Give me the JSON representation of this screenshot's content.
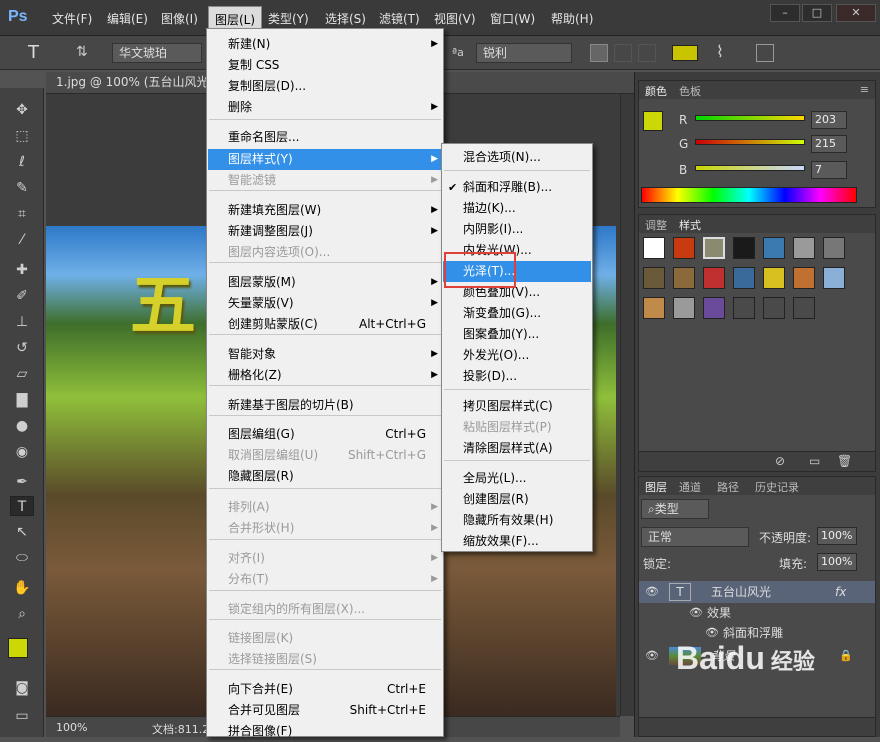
{
  "menubar": {
    "logo": "Ps",
    "items": [
      "文件(F)",
      "编辑(E)",
      "图像(I)",
      "图层(L)",
      "类型(Y)",
      "选择(S)",
      "滤镜(T)",
      "视图(V)",
      "窗口(W)",
      "帮助(H)"
    ],
    "window_buttons": [
      "–",
      "□",
      "✕"
    ]
  },
  "options": {
    "font_family": "华文琥珀",
    "antialias": "锐利",
    "tool_glyph": "T",
    "color": "#c8c400"
  },
  "document": {
    "tab_title": "1.jpg @ 100% (五台山风光,",
    "zoom": "100%",
    "doc_info": "文档:811.2"
  },
  "canvas": {
    "overlay_text": "五"
  },
  "color_panel": {
    "tabs": [
      "颜色",
      "色板"
    ],
    "labels": [
      "R",
      "G",
      "B"
    ],
    "values": [
      "203",
      "215",
      "7"
    ],
    "fg_color": "#cbd707",
    "bg_color": "#ffffff"
  },
  "styles_panel": {
    "tabs": [
      "调整",
      "样式"
    ]
  },
  "layers_panel": {
    "tabs": [
      "图层",
      "通道",
      "路径",
      "历史记录"
    ],
    "filter_kind": "类型",
    "blend_mode": "正常",
    "opacity_label": "不透明度:",
    "opacity": "100%",
    "lock_label": "锁定:",
    "fill_label": "填充:",
    "fill": "100%",
    "layers": [
      {
        "name": "五台山风光",
        "type": "text",
        "fx": "fx"
      },
      {
        "name": "效果",
        "type": "effect-group"
      },
      {
        "name": "斜面和浮雕",
        "type": "effect"
      },
      {
        "name": "背景",
        "type": "background"
      }
    ]
  },
  "layer_menu": {
    "items": [
      {
        "label": "新建(N)",
        "submenu": true
      },
      {
        "label": "复制 CSS"
      },
      {
        "label": "复制图层(D)..."
      },
      {
        "label": "删除",
        "submenu": true
      },
      {
        "label": "重命名图层..."
      },
      {
        "label": "图层样式(Y)",
        "submenu": true,
        "highlight": true
      },
      {
        "label": "智能滤镜",
        "submenu": true,
        "disabled": true
      },
      {
        "label": "新建填充图层(W)",
        "submenu": true
      },
      {
        "label": "新建调整图层(J)",
        "submenu": true
      },
      {
        "label": "图层内容选项(O)...",
        "disabled": true
      },
      {
        "label": "图层蒙版(M)",
        "submenu": true
      },
      {
        "label": "矢量蒙版(V)",
        "submenu": true
      },
      {
        "label": "创建剪贴蒙版(C)",
        "shortcut": "Alt+Ctrl+G"
      },
      {
        "label": "智能对象",
        "submenu": true
      },
      {
        "label": "栅格化(Z)",
        "submenu": true
      },
      {
        "label": "新建基于图层的切片(B)"
      },
      {
        "label": "图层编组(G)",
        "shortcut": "Ctrl+G"
      },
      {
        "label": "取消图层编组(U)",
        "shortcut": "Shift+Ctrl+G",
        "disabled": true
      },
      {
        "label": "隐藏图层(R)"
      },
      {
        "label": "排列(A)",
        "submenu": true,
        "disabled": true
      },
      {
        "label": "合并形状(H)",
        "submenu": true,
        "disabled": true
      },
      {
        "label": "对齐(I)",
        "submenu": true,
        "disabled": true
      },
      {
        "label": "分布(T)",
        "submenu": true,
        "disabled": true
      },
      {
        "label": "锁定组内的所有图层(X)...",
        "disabled": true
      },
      {
        "label": "链接图层(K)",
        "disabled": true
      },
      {
        "label": "选择链接图层(S)",
        "disabled": true
      },
      {
        "label": "向下合并(E)",
        "shortcut": "Ctrl+E"
      },
      {
        "label": "合并可见图层",
        "shortcut": "Shift+Ctrl+E"
      },
      {
        "label": "拼合图像(F)"
      }
    ]
  },
  "style_submenu": {
    "items": [
      {
        "label": "混合选项(N)..."
      },
      {
        "label": "斜面和浮雕(B)...",
        "checked": true
      },
      {
        "label": "描边(K)..."
      },
      {
        "label": "内阴影(I)..."
      },
      {
        "label": "内发光(W)..."
      },
      {
        "label": "光泽(T)...",
        "highlight": true
      },
      {
        "label": "颜色叠加(V)..."
      },
      {
        "label": "渐变叠加(G)..."
      },
      {
        "label": "图案叠加(Y)..."
      },
      {
        "label": "外发光(O)..."
      },
      {
        "label": "投影(D)..."
      },
      {
        "label": "拷贝图层样式(C)"
      },
      {
        "label": "粘贴图层样式(P)",
        "disabled": true
      },
      {
        "label": "清除图层样式(A)"
      },
      {
        "label": "全局光(L)..."
      },
      {
        "label": "创建图层(R)"
      },
      {
        "label": "隐藏所有效果(H)"
      },
      {
        "label": "缩放效果(F)..."
      }
    ]
  },
  "watermark": {
    "brand": "Baidu",
    "sub": "经验"
  }
}
